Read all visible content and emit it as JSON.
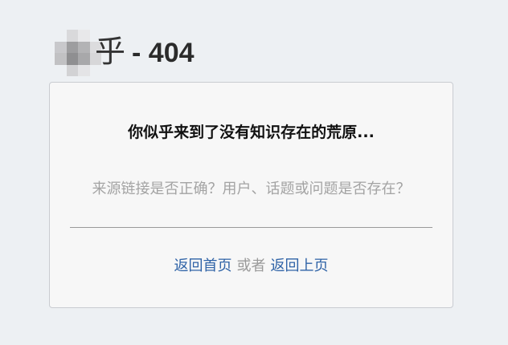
{
  "header": {
    "logo_char": "乎",
    "title_suffix": "- 404"
  },
  "card": {
    "headline": "你似乎来到了没有知识存在的荒原...",
    "question": "来源链接是否正确？用户、话题或问题是否存在？",
    "links": {
      "home": "返回首页",
      "separator": "或者",
      "back": "返回上页"
    }
  },
  "colors": {
    "background": "#edf0f3",
    "card_background": "#f7f7f7",
    "link": "#2f63a7",
    "muted_text": "#a3a3a3"
  },
  "icons": {
    "logo": "pixelated-logo-icon"
  }
}
